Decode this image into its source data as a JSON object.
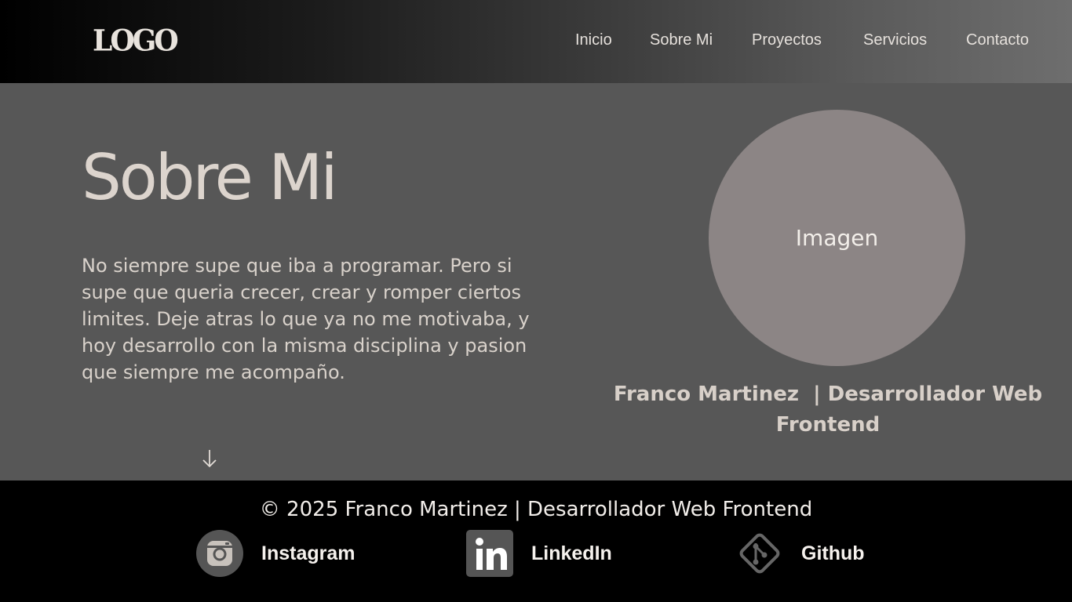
{
  "header": {
    "logo_text": "LOGO",
    "nav": [
      {
        "label": "Inicio"
      },
      {
        "label": "Sobre Mi"
      },
      {
        "label": "Proyectos"
      },
      {
        "label": "Servicios"
      },
      {
        "label": "Contacto"
      }
    ]
  },
  "main": {
    "title": "Sobre Mi",
    "paragraph": "No siempre supe que iba a programar. Pero si supe que queria crecer, crear y romper ciertos limites. Deje atras lo que ya no me motivaba, y hoy desarrollo con la misma disciplina y pasion que siempre me acompaño.",
    "scroll_icon": "arrow-down-icon",
    "image_placeholder": "Imagen",
    "caption": "Franco Martinez  | Desarrollador Web Frontend"
  },
  "footer": {
    "copyright": "© 2025 Franco Martinez | Desarrollador Web Frontend",
    "socials": [
      {
        "label": "Instagram",
        "icon": "instagram-icon"
      },
      {
        "label": "LinkedIn",
        "icon": "linkedin-icon"
      },
      {
        "label": "Github",
        "icon": "git-icon"
      }
    ]
  },
  "colors": {
    "background": "#575757",
    "footer_bg": "#000000",
    "text_light": "#dcd4cd",
    "avatar_circle": "#8c8585"
  }
}
